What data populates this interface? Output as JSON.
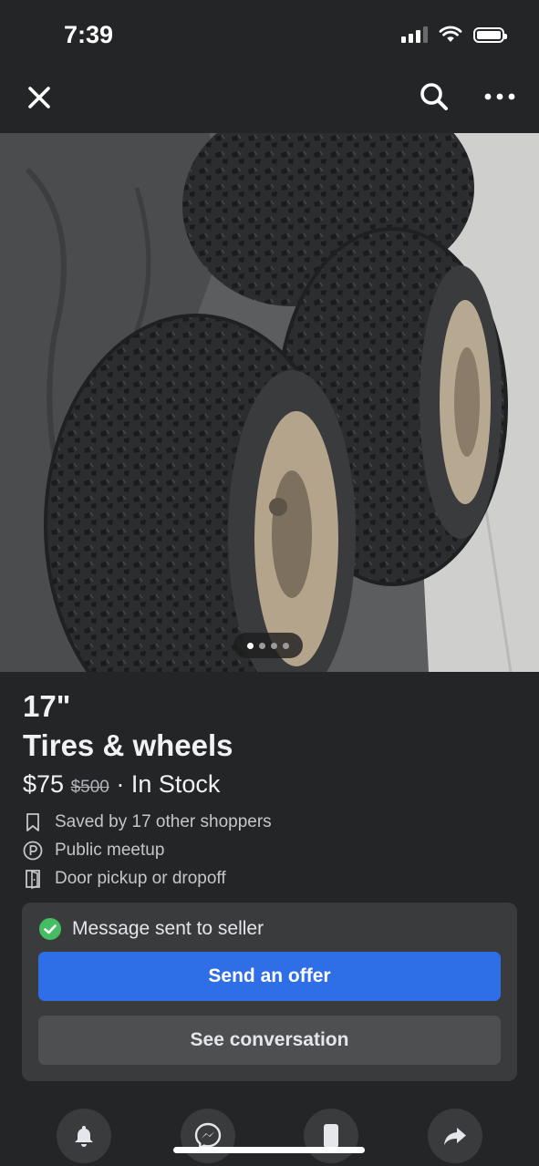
{
  "status_bar": {
    "time": "7:39"
  },
  "nav": {
    "close_icon": "close-icon",
    "search_icon": "search-icon",
    "more_icon": "more-icon"
  },
  "gallery": {
    "photo_count": 4,
    "active_index": 0
  },
  "listing": {
    "title_line1": "17\"",
    "title_line2": "Tires & wheels",
    "price": "$75",
    "original_price": "$500",
    "availability": "· In Stock",
    "details": [
      {
        "icon": "bookmark-icon",
        "text": "Saved by 17 other shoppers"
      },
      {
        "icon": "parking-icon",
        "text": "Public meetup"
      },
      {
        "icon": "door-icon",
        "text": "Door pickup or dropoff"
      }
    ]
  },
  "message_card": {
    "status": "Message sent to seller",
    "primary_button": "Send an offer",
    "secondary_button": "See conversation"
  },
  "actions": [
    "bell-icon",
    "messenger-icon",
    "phone-icon",
    "share-icon"
  ],
  "colors": {
    "background": "#242526",
    "accent": "#2e6ee6",
    "success": "#45bd62"
  }
}
